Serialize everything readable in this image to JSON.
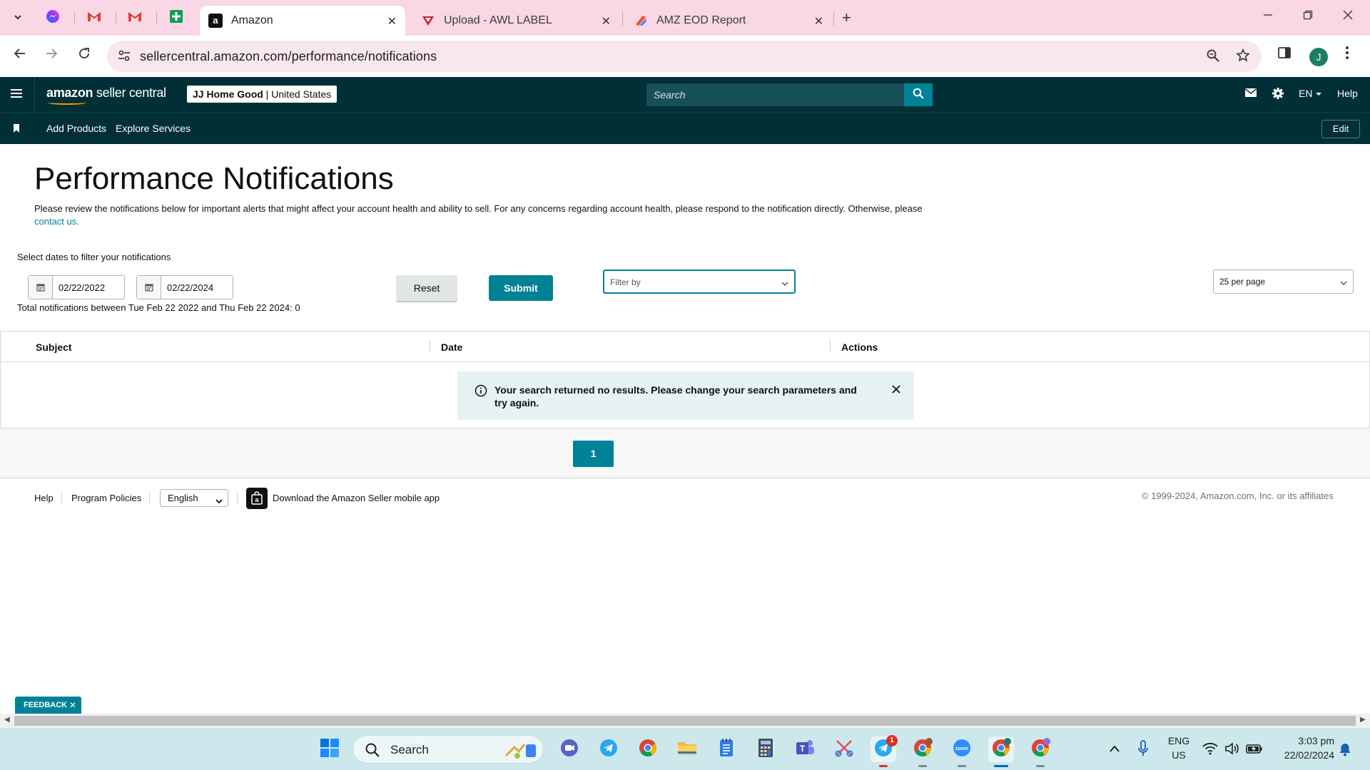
{
  "browser": {
    "tabs": [
      {
        "title": "Amazon",
        "active": true
      },
      {
        "title": "Upload - AWL LABEL",
        "active": false
      },
      {
        "title": "AMZ EOD Report",
        "active": false
      }
    ],
    "url": "sellercentral.amazon.com/performance/notifications",
    "profile_initial": "J"
  },
  "header": {
    "logo_bold": "amazon",
    "logo_rest": " seller central",
    "merchant_name": "JJ Home Good",
    "merchant_region": "United States",
    "search_placeholder": "Search",
    "language": "EN",
    "help": "Help"
  },
  "subnav": {
    "items": [
      "Add Products",
      "Explore Services"
    ],
    "edit": "Edit"
  },
  "page": {
    "title": "Performance Notifications",
    "intro_text": "Please review the notifications below for important alerts that might affect your account health and ability to sell. For any concerns regarding account health, please respond to the notification directly. Otherwise, please ",
    "intro_link": "contact us.",
    "filter_label": "Select dates to filter your notifications",
    "start_date": "02/22/2022",
    "end_date": "02/22/2024",
    "reset": "Reset",
    "submit": "Submit",
    "filter_placeholder": "Filter by",
    "per_page": "25 per page",
    "total_line": "Total notifications between Tue Feb 22 2022 and Thu Feb 22 2024: 0"
  },
  "table": {
    "columns": [
      "Subject",
      "Date",
      "Actions"
    ],
    "empty_message": "Your search returned no results. Please change your search parameters and try again."
  },
  "pagination": {
    "current": "1"
  },
  "footer": {
    "help": "Help",
    "policies": "Program Policies",
    "language": "English",
    "app_text": "Download the Amazon Seller mobile app",
    "copyright": "© 1999-2024, Amazon.com, Inc. or its affiliates"
  },
  "feedback": "FEEDBACK",
  "taskbar": {
    "search": "Search",
    "lang_line1": "ENG",
    "lang_line2": "US",
    "time": "3:03 pm",
    "date": "22/02/2024",
    "telegram_badge": "1"
  },
  "colors": {
    "header_bg": "#002f36",
    "accent": "#008296",
    "tabstrip": "#f9d7e5",
    "taskbar": "#cce8ec"
  }
}
